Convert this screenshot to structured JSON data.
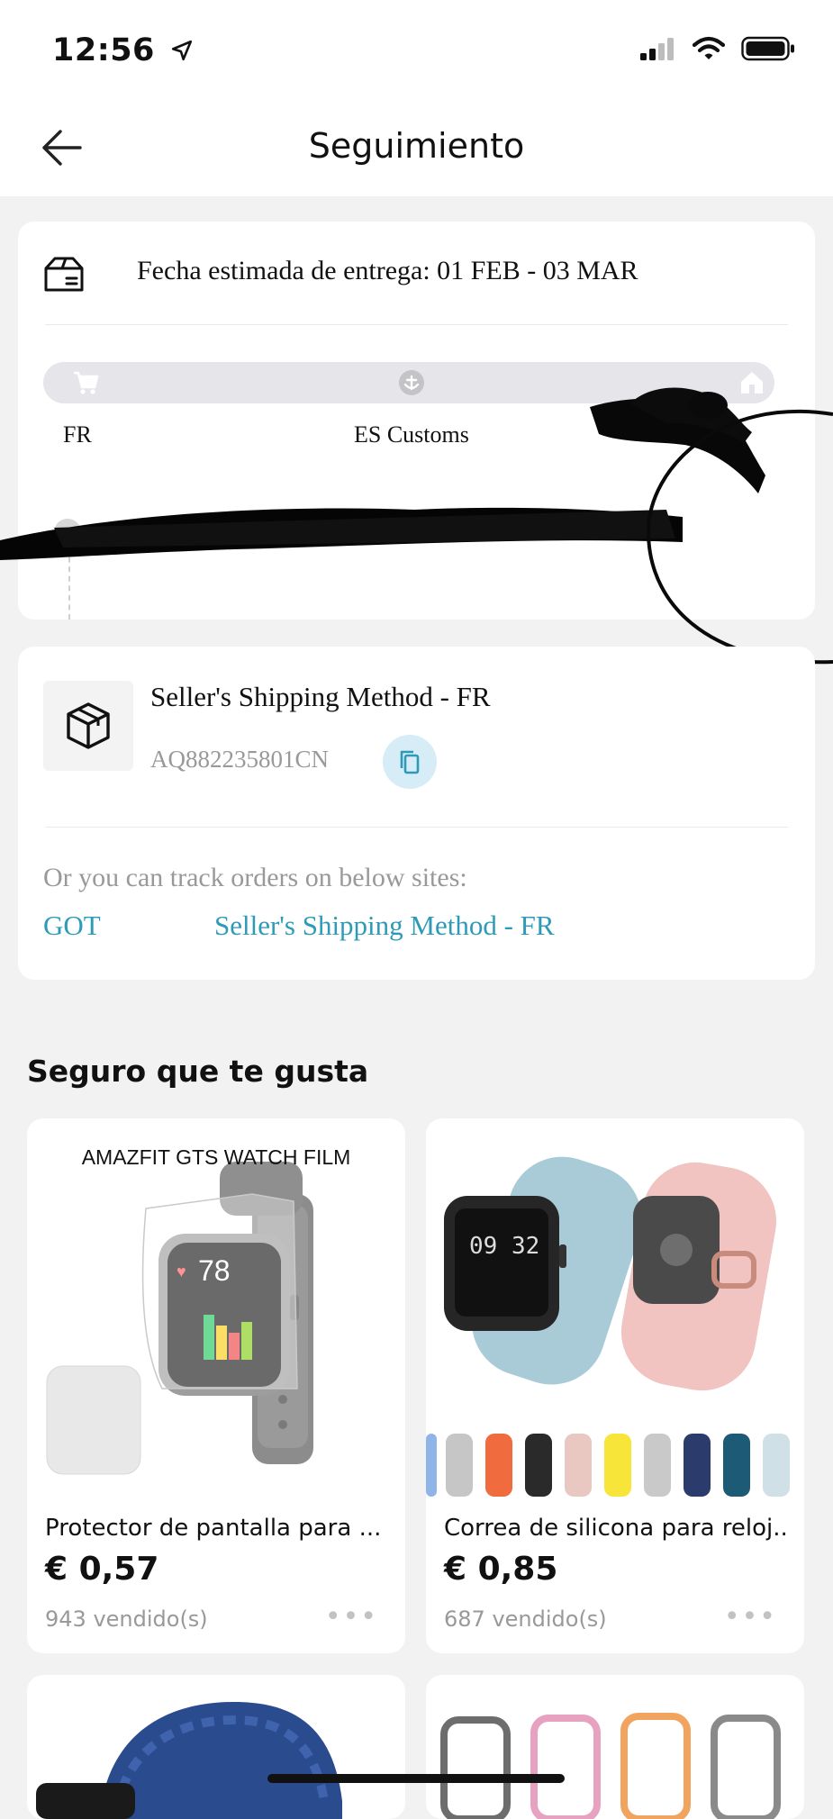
{
  "status_bar": {
    "time": "12:56"
  },
  "header": {
    "title": "Seguimiento"
  },
  "delivery": {
    "estimate": "Fecha estimada de entrega: 01 FEB - 03 MAR",
    "stages": [
      "FR",
      "ES Customs"
    ]
  },
  "shipping": {
    "method": "Seller's Shipping Method - FR",
    "tracking_number": "AQ882235801CN",
    "track_intro": "Or you can track orders on below sites:",
    "links": [
      "GOT",
      "Seller's Shipping Method - FR"
    ]
  },
  "recommendations": {
    "title": "Seguro que te gusta",
    "items": [
      {
        "name": "Protector de pantalla para ...",
        "price": "€ 0,57",
        "sold": "943 vendido(s)",
        "image_text": "AMAZFIT GTS WATCH FILM",
        "watch_reading": "78"
      },
      {
        "name": "Correa de silicona para reloj...",
        "price": "€ 0,85",
        "sold": "687 vendido(s)",
        "watch_time": "09 32"
      }
    ]
  },
  "colors": {
    "link": "#2d9ab8",
    "background": "#f2f2f2",
    "copy_button": "#d6ecf6"
  }
}
